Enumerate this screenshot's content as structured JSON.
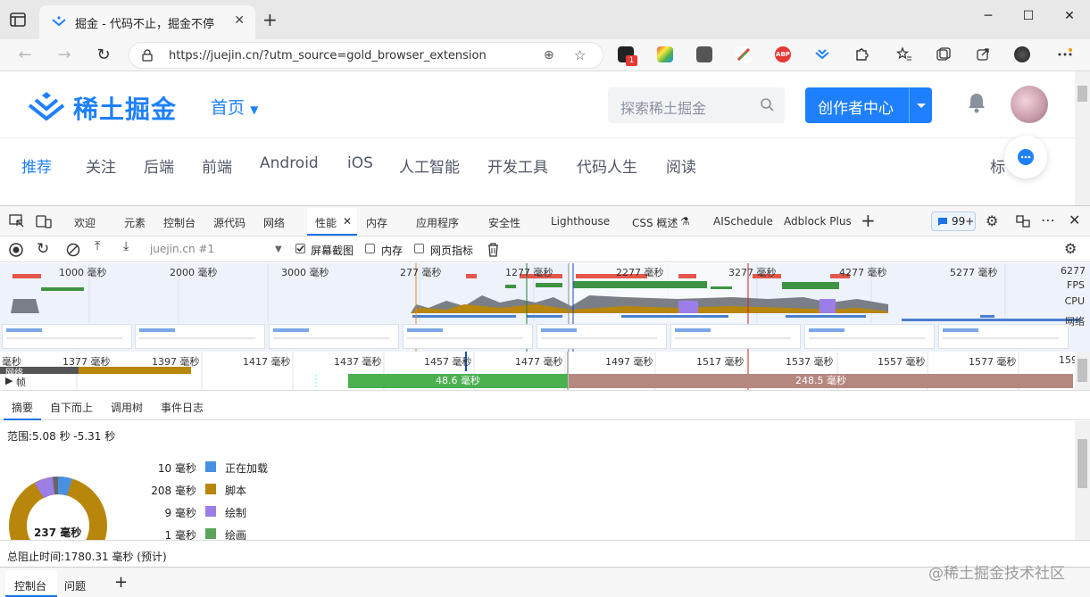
{
  "browser": {
    "tab_title": "掘金 - 代码不止，掘金不停",
    "url": "https://juejin.cn/?utm_source=gold_browser_extension",
    "ext_badge_count": "1"
  },
  "juejin": {
    "logo_text": "稀土掘金",
    "home_label": "首页",
    "search_placeholder": "探索稀土掘金",
    "creator_button": "创作者中心",
    "nav_items": [
      "推荐",
      "关注",
      "后端",
      "前端",
      "Android",
      "iOS",
      "人工智能",
      "开发工具",
      "代码人生",
      "阅读",
      "标"
    ]
  },
  "devtools": {
    "tabs": [
      "欢迎",
      "元素",
      "控制台",
      "源代码",
      "网络",
      "性能",
      "内存",
      "应用程序",
      "安全性",
      "Lighthouse",
      "CSS 概述",
      "AISchedule",
      "Adblock Plus"
    ],
    "issues_badge": "99+",
    "target_select": "juejin.cn #1",
    "checkboxes": [
      {
        "label": "屏幕截图",
        "checked": true
      },
      {
        "label": "内存",
        "checked": false
      },
      {
        "label": "网页指标",
        "checked": false
      }
    ],
    "overview_ticks": [
      "1000 毫秒",
      "2000 毫秒",
      "3000 毫秒",
      "277 毫秒",
      "1277 毫秒",
      "2277 毫秒",
      "3277 毫秒",
      "4277 毫秒",
      "5277 毫秒",
      "6277"
    ],
    "overview_lanes": [
      "FPS",
      "CPU",
      "网络"
    ],
    "timeline_ticks": [
      "毫秒",
      "1377 毫秒",
      "1397 毫秒",
      "1417 毫秒",
      "1437 毫秒",
      "1457 毫秒",
      "1477 毫秒",
      "1497 毫秒",
      "1517 毫秒",
      "1537 毫秒",
      "1557 毫秒",
      "1577 毫秒",
      "159"
    ],
    "frames_label": "帧",
    "network_label": "网络",
    "frame_good": "48.6 毫秒",
    "frame_bad": "248.5 毫秒",
    "detail_tabs": [
      "摘要",
      "自下而上",
      "调用树",
      "事件日志"
    ],
    "range": "范围:5.08 秒 -5.31 秒",
    "summary_items": [
      {
        "value": "10 毫秒",
        "name": "正在加载",
        "color": "#4a90e2"
      },
      {
        "value": "208 毫秒",
        "name": "脚本",
        "color": "#b8860b"
      },
      {
        "value": "9 毫秒",
        "name": "绘制",
        "color": "#9c7ee8"
      },
      {
        "value": "1 毫秒",
        "name": "绘画",
        "color": "#5aa55a"
      }
    ],
    "total_label": "237 毫秒",
    "blocking_time": "总阻止时间:1780.31 毫秒 (预计)",
    "drawer_tabs": [
      "控制台",
      "问题"
    ]
  },
  "watermark": "@稀土掘金技术社区"
}
